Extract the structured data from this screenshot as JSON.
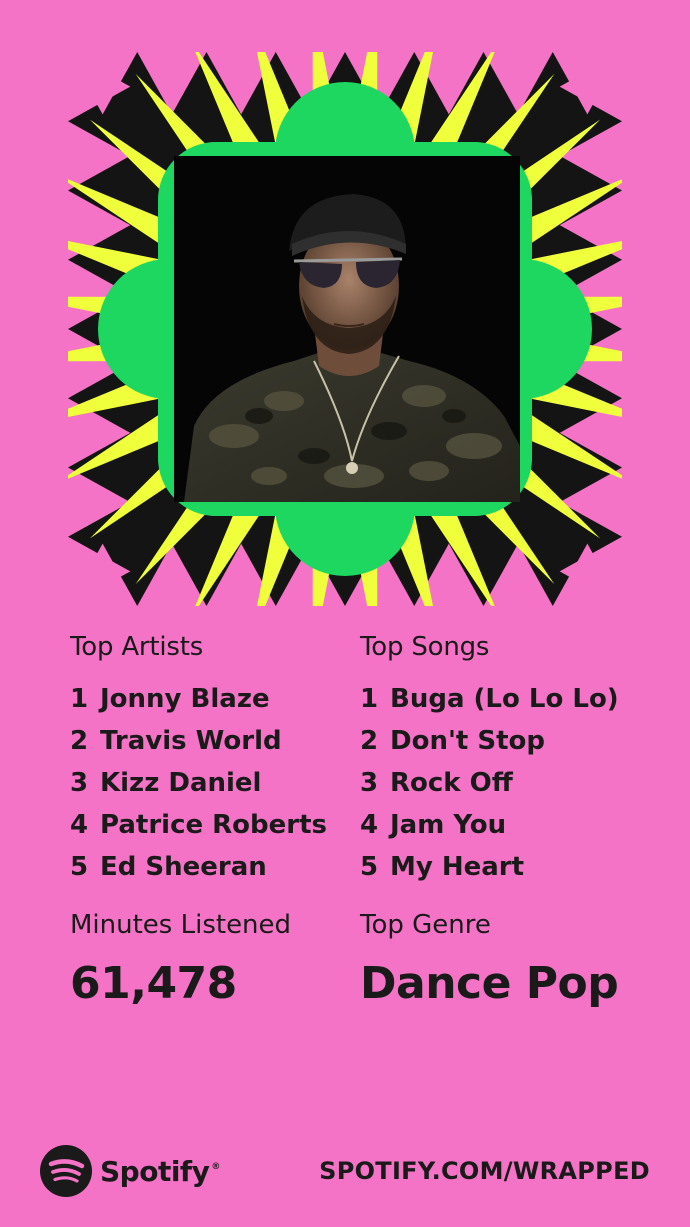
{
  "colors": {
    "background": "#f573c6",
    "art_black": "#141414",
    "art_yellow": "#f0ff3c",
    "art_green": "#1ed760",
    "art_pink": "#f573c6",
    "text": "#1a1a1a"
  },
  "artwork": {
    "photo": "portrait of man wearing backwards cap, aviator sunglasses and camo t-shirt"
  },
  "top_artists": {
    "label": "Top Artists",
    "items": [
      {
        "rank": "1",
        "name": "Jonny Blaze"
      },
      {
        "rank": "2",
        "name": "Travis World"
      },
      {
        "rank": "3",
        "name": "Kizz Daniel"
      },
      {
        "rank": "4",
        "name": "Patrice Roberts"
      },
      {
        "rank": "5",
        "name": "Ed Sheeran"
      }
    ]
  },
  "top_songs": {
    "label": "Top Songs",
    "items": [
      {
        "rank": "1",
        "name": "Buga (Lo Lo Lo)"
      },
      {
        "rank": "2",
        "name": "Don't Stop"
      },
      {
        "rank": "3",
        "name": "Rock Off"
      },
      {
        "rank": "4",
        "name": "Jam You"
      },
      {
        "rank": "5",
        "name": "My Heart"
      }
    ]
  },
  "minutes": {
    "label": "Minutes Listened",
    "value": "61,478"
  },
  "genre": {
    "label": "Top Genre",
    "value": "Dance Pop"
  },
  "footer": {
    "brand": "Spotify",
    "trademark": "®",
    "url": "SPOTIFY.COM/WRAPPED",
    "logo_icon": "spotify-logo-icon"
  }
}
